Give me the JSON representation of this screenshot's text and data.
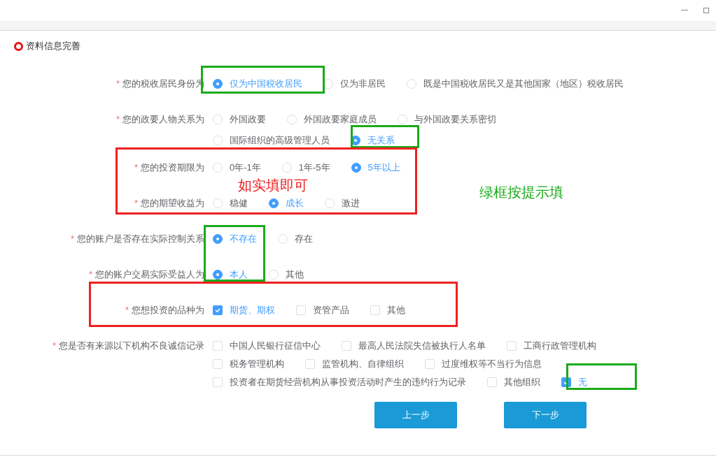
{
  "section_title": "资料信息完善",
  "questions": [
    {
      "marker": "*",
      "label": "您的税收居民身份为",
      "kind": "radio",
      "lines": [
        [
          {
            "label": "仅为中国税收居民",
            "selected": true
          },
          {
            "label": "仅为非居民",
            "selected": false
          },
          {
            "label": "既是中国税收居民又是其他国家（地区）税收居民",
            "selected": false
          }
        ]
      ]
    },
    {
      "marker": "*",
      "label": "您的政要人物关系为",
      "kind": "radio",
      "lines": [
        [
          {
            "label": "外国政要",
            "selected": false
          },
          {
            "label": "外国政要家庭成员",
            "selected": false
          },
          {
            "label": "与外国政要关系密切",
            "selected": false
          }
        ],
        [
          {
            "label": "国际组织的高级管理人员",
            "selected": false
          },
          {
            "label": "无关系",
            "selected": true
          }
        ]
      ]
    },
    {
      "marker": "*",
      "label": "您的投资期限为",
      "kind": "radio",
      "lines": [
        [
          {
            "label": "0年-1年",
            "selected": false
          },
          {
            "label": "1年-5年",
            "selected": false
          },
          {
            "label": "5年以上",
            "selected": true
          }
        ]
      ]
    },
    {
      "marker": "*",
      "label": "您的期望收益为",
      "kind": "radio",
      "lines": [
        [
          {
            "label": "稳健",
            "selected": false
          },
          {
            "label": "成长",
            "selected": true
          },
          {
            "label": "激进",
            "selected": false
          }
        ]
      ]
    },
    {
      "marker": "*",
      "label": "您的账户是否存在实际控制关系",
      "kind": "radio",
      "lines": [
        [
          {
            "label": "不存在",
            "selected": true
          },
          {
            "label": "存在",
            "selected": false
          }
        ]
      ]
    },
    {
      "marker": "*",
      "label": "您的账户交易实际受益人为",
      "kind": "radio",
      "lines": [
        [
          {
            "label": "本人",
            "selected": true
          },
          {
            "label": "其他",
            "selected": false
          }
        ]
      ]
    },
    {
      "marker": "*",
      "label": "您想投资的品种为",
      "kind": "checkbox",
      "lines": [
        [
          {
            "label": "期货、期权",
            "selected": true
          },
          {
            "label": "资管产品",
            "selected": false
          },
          {
            "label": "其他",
            "selected": false
          }
        ]
      ]
    },
    {
      "marker": "*",
      "label": "您是否有来源以下机构不良诚信记录",
      "kind": "checkbox",
      "lines": [
        [
          {
            "label": "中国人民银行征信中心",
            "selected": false
          },
          {
            "label": "最高人民法院失信被执行人名单",
            "selected": false
          },
          {
            "label": "工商行政管理机构",
            "selected": false
          }
        ],
        [
          {
            "label": "税务管理机构",
            "selected": false
          },
          {
            "label": "监管机构、自律组织",
            "selected": false
          },
          {
            "label": "过度维权等不当行为信息",
            "selected": false
          }
        ],
        [
          {
            "label": "投资者在期货经营机构从事投资活动时产生的违约行为记录",
            "selected": false
          },
          {
            "label": "其他组织",
            "selected": false
          },
          {
            "label": "无",
            "selected": true
          }
        ]
      ]
    }
  ],
  "buttons": [
    "上一步",
    "下一步"
  ],
  "annotations": [
    {
      "kind": "box",
      "color": "#1aab1a"
    },
    {
      "kind": "box",
      "color": "#1aab1a"
    },
    {
      "kind": "box",
      "color": "#ee2020"
    },
    {
      "kind": "note",
      "color": "#ee2020",
      "text": "如实填即可"
    },
    {
      "kind": "note",
      "color": "#1aab1a",
      "text": "绿框按提示填"
    },
    {
      "kind": "box",
      "color": "#1aab1a"
    },
    {
      "kind": "box",
      "color": "#ee2020"
    },
    {
      "kind": "box",
      "color": "#1aab1a"
    }
  ]
}
